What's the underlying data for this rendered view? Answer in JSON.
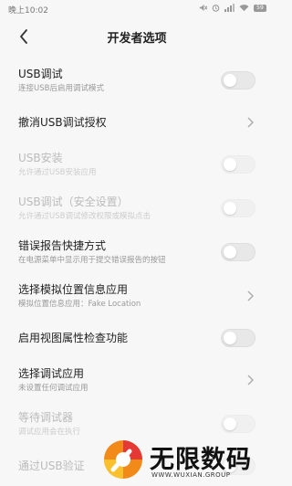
{
  "status_bar": {
    "time": "晚上10:02",
    "icons": [
      "mute-icon",
      "alarm-icon",
      "signal-icon",
      "wifi-icon",
      "battery-icon"
    ],
    "battery": "59"
  },
  "header": {
    "title": "开发者选项"
  },
  "settings": {
    "items": [
      {
        "title": "USB调试",
        "subtitle": "连接USB后启用调试模式",
        "control": "toggle",
        "on": false,
        "enabled": true
      },
      {
        "title": "撤消USB调试授权",
        "subtitle": "",
        "control": "chevron",
        "enabled": true
      },
      {
        "title": "USB安装",
        "subtitle": "允许通过USB安装应用",
        "control": "toggle",
        "on": false,
        "enabled": false
      },
      {
        "title": "USB调试（安全设置）",
        "subtitle": "允许通过USB调试修改权限或模拟点击",
        "control": "toggle",
        "on": false,
        "enabled": false
      },
      {
        "title": "错误报告快捷方式",
        "subtitle": "在电源菜单中显示用于提交错误报告的按钮",
        "control": "toggle",
        "on": false,
        "enabled": true
      },
      {
        "title": "选择模拟位置信息应用",
        "subtitle": "模拟位置信息应用：Fake Location",
        "control": "chevron",
        "enabled": true
      },
      {
        "title": "启用视图属性检查功能",
        "subtitle": "",
        "control": "toggle",
        "on": false,
        "enabled": true
      },
      {
        "title": "选择调试应用",
        "subtitle": "未设置任何调试应用",
        "control": "chevron",
        "enabled": true
      },
      {
        "title": "等待调试器",
        "subtitle": "调试应用会在执行",
        "control": "toggle",
        "on": false,
        "enabled": false
      },
      {
        "title": "通过USB验证",
        "subtitle": "",
        "control": "toggle",
        "on": false,
        "enabled": false
      }
    ]
  },
  "watermark": {
    "name": "无限数码",
    "url": "WWW.WUXIAN.GROUP"
  },
  "colors": {
    "background": "#f7f7f7",
    "toggle_off": "#e8e8e8",
    "text_primary": "#222222",
    "text_secondary": "#999999",
    "text_disabled": "#bbbbbb"
  }
}
